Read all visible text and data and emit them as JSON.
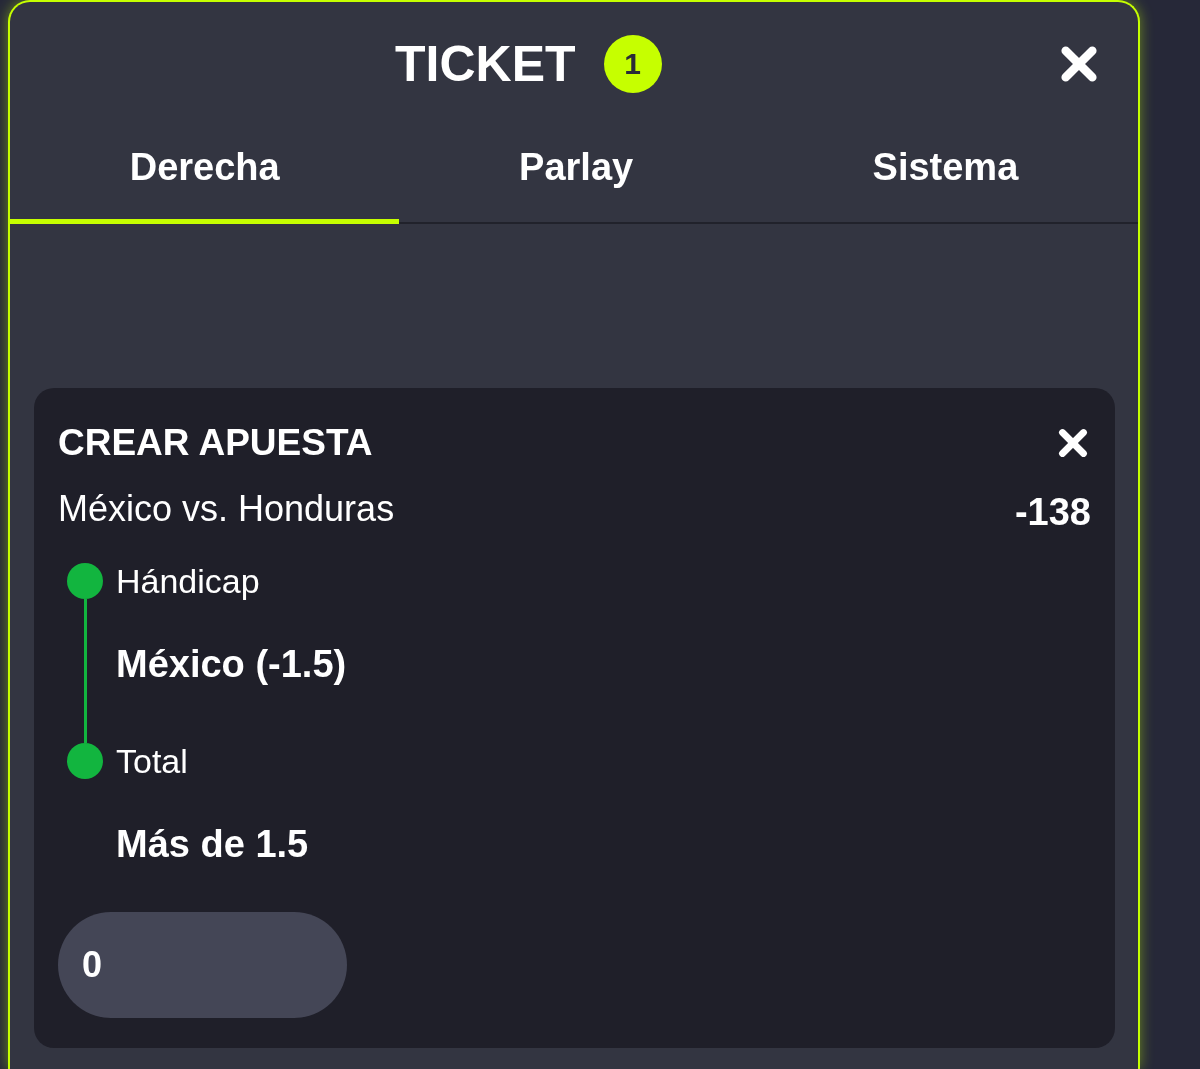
{
  "header": {
    "title": "TICKET",
    "badge": "1"
  },
  "tabs": [
    {
      "label": "Derecha",
      "selected": true
    },
    {
      "label": "Parlay",
      "selected": false
    },
    {
      "label": "Sistema",
      "selected": false
    }
  ],
  "bet_card": {
    "title": "CREAR APUESTA",
    "match": "México vs. Honduras",
    "odds": "-138",
    "selections": [
      {
        "market": "Hándicap",
        "pick": "México (-1.5)"
      },
      {
        "market": "Total",
        "pick": "Más de 1.5"
      }
    ],
    "stake": {
      "value": "0"
    }
  }
}
